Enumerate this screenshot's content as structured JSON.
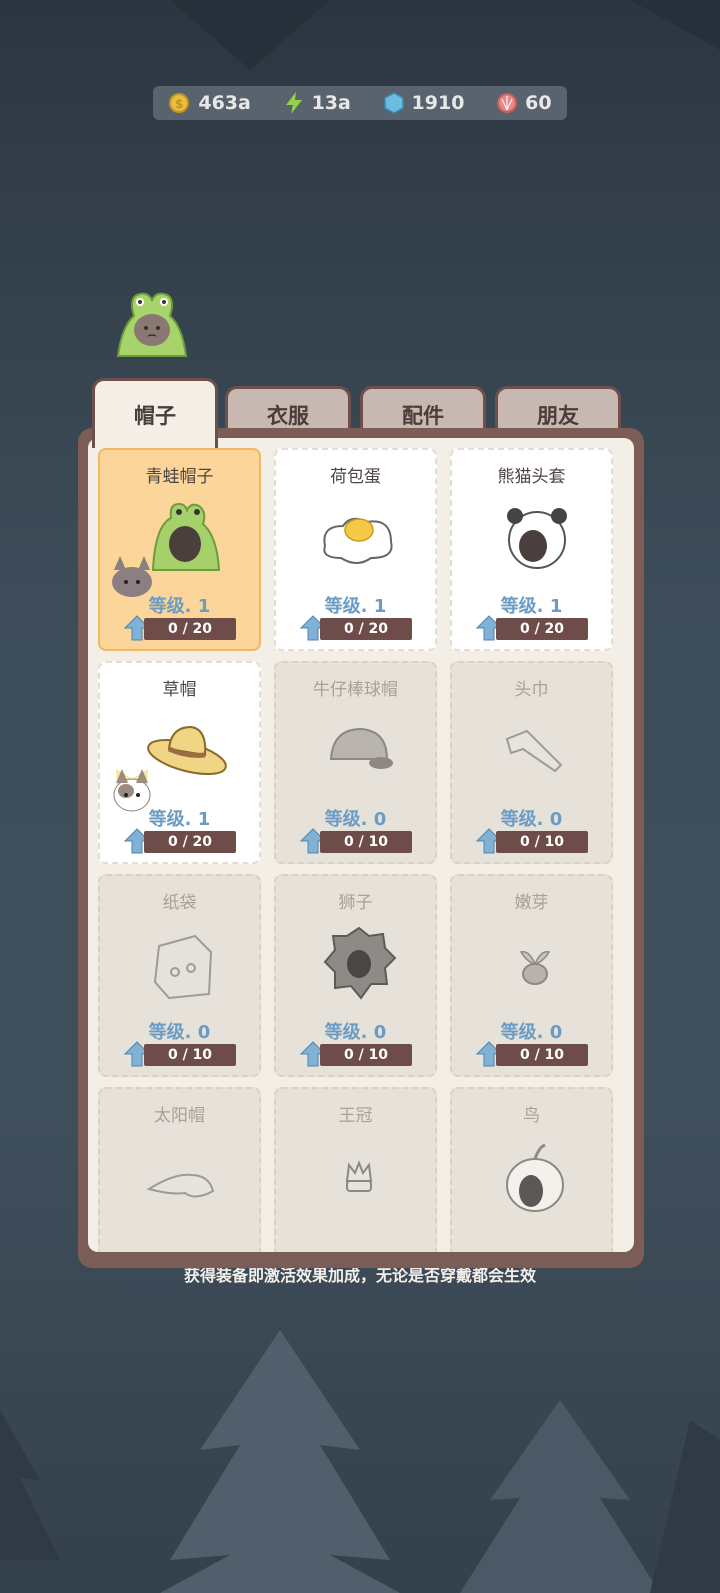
{
  "resources": [
    {
      "icon": "gold-coin-icon",
      "value": "463a"
    },
    {
      "icon": "lightning-icon",
      "value": "13a"
    },
    {
      "icon": "diamond-icon",
      "value": "1910"
    },
    {
      "icon": "pink-shell-icon",
      "value": "60"
    }
  ],
  "tabs": [
    "帽子",
    "衣服",
    "配件",
    "朋友"
  ],
  "items": [
    {
      "name": "青蛙帽子",
      "level": "等级. 1",
      "progress": "0 / 20",
      "state": "selected"
    },
    {
      "name": "荷包蛋",
      "level": "等级. 1",
      "progress": "0 / 20",
      "state": "owned"
    },
    {
      "name": "熊猫头套",
      "level": "等级. 1",
      "progress": "0 / 20",
      "state": "owned"
    },
    {
      "name": "草帽",
      "level": "等级. 1",
      "progress": "0 / 20",
      "state": "owned"
    },
    {
      "name": "牛仔棒球帽",
      "level": "等级. 0",
      "progress": "0 / 10",
      "state": "locked"
    },
    {
      "name": "头巾",
      "level": "等级. 0",
      "progress": "0 / 10",
      "state": "locked"
    },
    {
      "name": "纸袋",
      "level": "等级. 0",
      "progress": "0 / 10",
      "state": "locked"
    },
    {
      "name": "狮子",
      "level": "等级. 0",
      "progress": "0 / 10",
      "state": "locked"
    },
    {
      "name": "嫩芽",
      "level": "等级. 0",
      "progress": "0 / 10",
      "state": "locked"
    },
    {
      "name": "太阳帽",
      "state": "locked"
    },
    {
      "name": "王冠",
      "state": "locked"
    },
    {
      "name": "鸟",
      "state": "locked"
    }
  ],
  "footer": "获得装备即激活效果加成，无论是否穿戴都会生效"
}
